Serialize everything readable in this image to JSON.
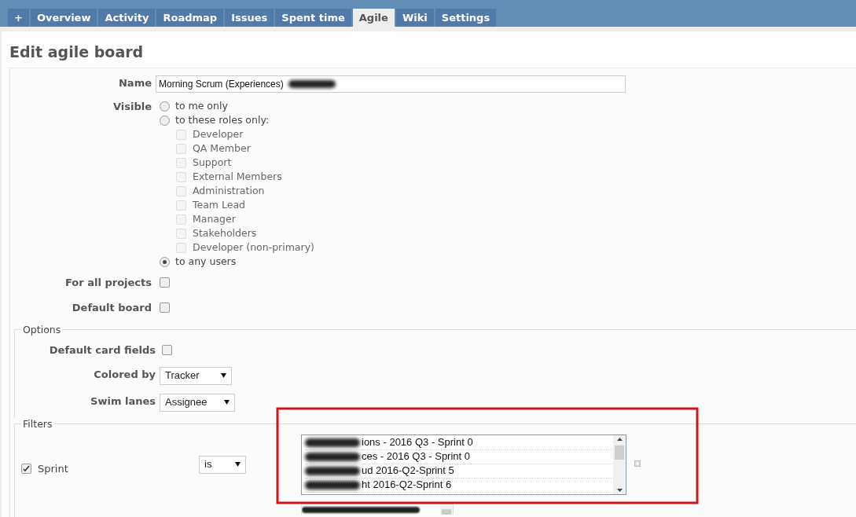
{
  "tabs": [
    {
      "label": "+",
      "selected": false
    },
    {
      "label": "Overview",
      "selected": false
    },
    {
      "label": "Activity",
      "selected": false
    },
    {
      "label": "Roadmap",
      "selected": false
    },
    {
      "label": "Issues",
      "selected": false
    },
    {
      "label": "Spent time",
      "selected": false
    },
    {
      "label": "Agile",
      "selected": true
    },
    {
      "label": "Wiki",
      "selected": false
    },
    {
      "label": "Settings",
      "selected": false
    }
  ],
  "title": "Edit agile board",
  "name": {
    "label": "Name",
    "value": "Morning Scrum (Experiences)"
  },
  "visible": {
    "label": "Visible",
    "options": [
      {
        "label": "to me only",
        "selected": false
      },
      {
        "label": "to these roles only:",
        "selected": false,
        "children": [
          {
            "label": "Developer",
            "checked": false,
            "disabled": true
          },
          {
            "label": "QA Member",
            "checked": false,
            "disabled": true
          },
          {
            "label": "Support",
            "checked": false,
            "disabled": true
          },
          {
            "label": "External Members",
            "checked": false,
            "disabled": true
          },
          {
            "label": "Administration",
            "checked": false,
            "disabled": true
          },
          {
            "label": "Team Lead",
            "checked": false,
            "disabled": true
          },
          {
            "label": "Manager",
            "checked": false,
            "disabled": true
          },
          {
            "label": "Stakeholders",
            "checked": false,
            "disabled": true
          },
          {
            "label": "Developer (non-primary)",
            "checked": false,
            "disabled": true
          }
        ]
      },
      {
        "label": "to any users",
        "selected": true
      }
    ]
  },
  "flags": [
    {
      "label": "For all projects",
      "checked": false
    },
    {
      "label": "Default board",
      "checked": false
    }
  ],
  "options": {
    "legend": "Options",
    "default_card_fields": {
      "label": "Default card fields",
      "checked": false
    },
    "selects": [
      {
        "label": "Colored by",
        "value": "Tracker"
      },
      {
        "label": "Swim lanes",
        "value": "Assignee"
      }
    ]
  },
  "filters": {
    "legend": "Filters",
    "rows": [
      {
        "label": "Sprint",
        "checked": true,
        "operator": "is",
        "values": [
          "ions - 2016 Q3 - Sprint 0",
          "ces - 2016 Q3 - Sprint 0",
          "ud 2016-Q2-Sprint 5",
          "ht 2016-Q2-Sprint 6"
        ]
      }
    ]
  }
}
